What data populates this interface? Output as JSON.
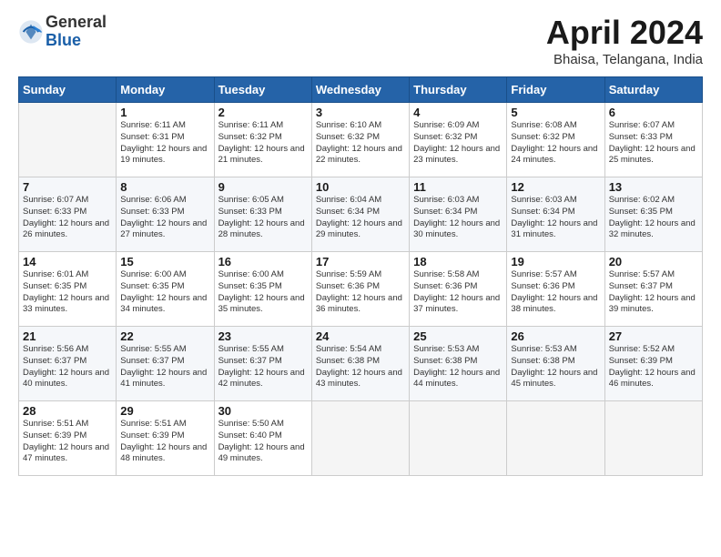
{
  "header": {
    "logo_general": "General",
    "logo_blue": "Blue",
    "title": "April 2024",
    "location": "Bhaisa, Telangana, India"
  },
  "columns": [
    "Sunday",
    "Monday",
    "Tuesday",
    "Wednesday",
    "Thursday",
    "Friday",
    "Saturday"
  ],
  "weeks": [
    [
      {
        "day": "",
        "sunrise": "",
        "sunset": "",
        "daylight": "",
        "empty": true
      },
      {
        "day": "1",
        "sunrise": "Sunrise: 6:11 AM",
        "sunset": "Sunset: 6:31 PM",
        "daylight": "Daylight: 12 hours and 19 minutes."
      },
      {
        "day": "2",
        "sunrise": "Sunrise: 6:11 AM",
        "sunset": "Sunset: 6:32 PM",
        "daylight": "Daylight: 12 hours and 21 minutes."
      },
      {
        "day": "3",
        "sunrise": "Sunrise: 6:10 AM",
        "sunset": "Sunset: 6:32 PM",
        "daylight": "Daylight: 12 hours and 22 minutes."
      },
      {
        "day": "4",
        "sunrise": "Sunrise: 6:09 AM",
        "sunset": "Sunset: 6:32 PM",
        "daylight": "Daylight: 12 hours and 23 minutes."
      },
      {
        "day": "5",
        "sunrise": "Sunrise: 6:08 AM",
        "sunset": "Sunset: 6:32 PM",
        "daylight": "Daylight: 12 hours and 24 minutes."
      },
      {
        "day": "6",
        "sunrise": "Sunrise: 6:07 AM",
        "sunset": "Sunset: 6:33 PM",
        "daylight": "Daylight: 12 hours and 25 minutes."
      }
    ],
    [
      {
        "day": "7",
        "sunrise": "Sunrise: 6:07 AM",
        "sunset": "Sunset: 6:33 PM",
        "daylight": "Daylight: 12 hours and 26 minutes."
      },
      {
        "day": "8",
        "sunrise": "Sunrise: 6:06 AM",
        "sunset": "Sunset: 6:33 PM",
        "daylight": "Daylight: 12 hours and 27 minutes."
      },
      {
        "day": "9",
        "sunrise": "Sunrise: 6:05 AM",
        "sunset": "Sunset: 6:33 PM",
        "daylight": "Daylight: 12 hours and 28 minutes."
      },
      {
        "day": "10",
        "sunrise": "Sunrise: 6:04 AM",
        "sunset": "Sunset: 6:34 PM",
        "daylight": "Daylight: 12 hours and 29 minutes."
      },
      {
        "day": "11",
        "sunrise": "Sunrise: 6:03 AM",
        "sunset": "Sunset: 6:34 PM",
        "daylight": "Daylight: 12 hours and 30 minutes."
      },
      {
        "day": "12",
        "sunrise": "Sunrise: 6:03 AM",
        "sunset": "Sunset: 6:34 PM",
        "daylight": "Daylight: 12 hours and 31 minutes."
      },
      {
        "day": "13",
        "sunrise": "Sunrise: 6:02 AM",
        "sunset": "Sunset: 6:35 PM",
        "daylight": "Daylight: 12 hours and 32 minutes."
      }
    ],
    [
      {
        "day": "14",
        "sunrise": "Sunrise: 6:01 AM",
        "sunset": "Sunset: 6:35 PM",
        "daylight": "Daylight: 12 hours and 33 minutes."
      },
      {
        "day": "15",
        "sunrise": "Sunrise: 6:00 AM",
        "sunset": "Sunset: 6:35 PM",
        "daylight": "Daylight: 12 hours and 34 minutes."
      },
      {
        "day": "16",
        "sunrise": "Sunrise: 6:00 AM",
        "sunset": "Sunset: 6:35 PM",
        "daylight": "Daylight: 12 hours and 35 minutes."
      },
      {
        "day": "17",
        "sunrise": "Sunrise: 5:59 AM",
        "sunset": "Sunset: 6:36 PM",
        "daylight": "Daylight: 12 hours and 36 minutes."
      },
      {
        "day": "18",
        "sunrise": "Sunrise: 5:58 AM",
        "sunset": "Sunset: 6:36 PM",
        "daylight": "Daylight: 12 hours and 37 minutes."
      },
      {
        "day": "19",
        "sunrise": "Sunrise: 5:57 AM",
        "sunset": "Sunset: 6:36 PM",
        "daylight": "Daylight: 12 hours and 38 minutes."
      },
      {
        "day": "20",
        "sunrise": "Sunrise: 5:57 AM",
        "sunset": "Sunset: 6:37 PM",
        "daylight": "Daylight: 12 hours and 39 minutes."
      }
    ],
    [
      {
        "day": "21",
        "sunrise": "Sunrise: 5:56 AM",
        "sunset": "Sunset: 6:37 PM",
        "daylight": "Daylight: 12 hours and 40 minutes."
      },
      {
        "day": "22",
        "sunrise": "Sunrise: 5:55 AM",
        "sunset": "Sunset: 6:37 PM",
        "daylight": "Daylight: 12 hours and 41 minutes."
      },
      {
        "day": "23",
        "sunrise": "Sunrise: 5:55 AM",
        "sunset": "Sunset: 6:37 PM",
        "daylight": "Daylight: 12 hours and 42 minutes."
      },
      {
        "day": "24",
        "sunrise": "Sunrise: 5:54 AM",
        "sunset": "Sunset: 6:38 PM",
        "daylight": "Daylight: 12 hours and 43 minutes."
      },
      {
        "day": "25",
        "sunrise": "Sunrise: 5:53 AM",
        "sunset": "Sunset: 6:38 PM",
        "daylight": "Daylight: 12 hours and 44 minutes."
      },
      {
        "day": "26",
        "sunrise": "Sunrise: 5:53 AM",
        "sunset": "Sunset: 6:38 PM",
        "daylight": "Daylight: 12 hours and 45 minutes."
      },
      {
        "day": "27",
        "sunrise": "Sunrise: 5:52 AM",
        "sunset": "Sunset: 6:39 PM",
        "daylight": "Daylight: 12 hours and 46 minutes."
      }
    ],
    [
      {
        "day": "28",
        "sunrise": "Sunrise: 5:51 AM",
        "sunset": "Sunset: 6:39 PM",
        "daylight": "Daylight: 12 hours and 47 minutes."
      },
      {
        "day": "29",
        "sunrise": "Sunrise: 5:51 AM",
        "sunset": "Sunset: 6:39 PM",
        "daylight": "Daylight: 12 hours and 48 minutes."
      },
      {
        "day": "30",
        "sunrise": "Sunrise: 5:50 AM",
        "sunset": "Sunset: 6:40 PM",
        "daylight": "Daylight: 12 hours and 49 minutes."
      },
      {
        "day": "",
        "sunrise": "",
        "sunset": "",
        "daylight": "",
        "empty": true
      },
      {
        "day": "",
        "sunrise": "",
        "sunset": "",
        "daylight": "",
        "empty": true
      },
      {
        "day": "",
        "sunrise": "",
        "sunset": "",
        "daylight": "",
        "empty": true
      },
      {
        "day": "",
        "sunrise": "",
        "sunset": "",
        "daylight": "",
        "empty": true
      }
    ]
  ]
}
